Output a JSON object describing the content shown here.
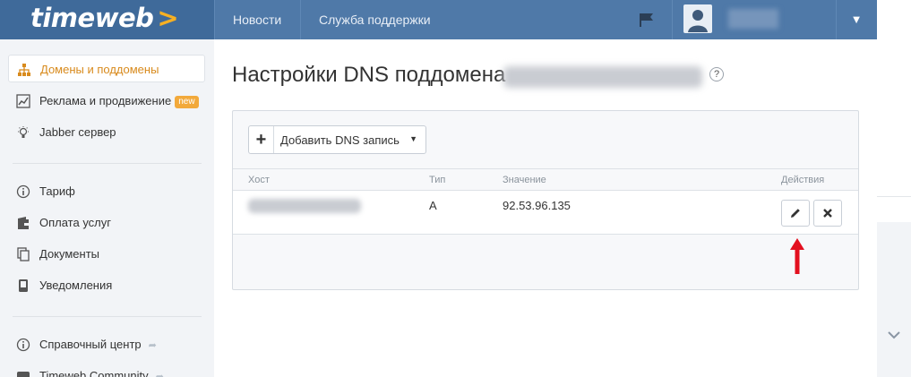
{
  "brand": {
    "logo": "timeweb",
    "logo_arrow": ">"
  },
  "topnav": {
    "news": "Новости",
    "support": "Служба поддержки",
    "user_caret": "▼"
  },
  "sidebar": {
    "items": [
      {
        "label": "Домены и поддомены",
        "icon": "sitemap-icon",
        "active": true
      },
      {
        "label": "Реклама и продвижение",
        "icon": "chart-icon",
        "badge": "new"
      },
      {
        "label": "Jabber сервер",
        "icon": "lightbulb-icon"
      },
      {
        "label": "Тариф",
        "icon": "info-icon"
      },
      {
        "label": "Оплата услуг",
        "icon": "wallet-icon"
      },
      {
        "label": "Документы",
        "icon": "documents-icon"
      },
      {
        "label": "Уведомления",
        "icon": "phone-icon"
      },
      {
        "label": "Справочный центр",
        "icon": "question-icon",
        "external": true
      },
      {
        "label": "Timeweb Community",
        "icon": "community-icon",
        "external": true
      }
    ],
    "ext_arrow": "➦"
  },
  "main": {
    "title": "Настройки DNS поддомена",
    "help": "?",
    "add_button": {
      "plus": "+",
      "label": "Добавить DNS запись",
      "caret": "▼"
    },
    "table": {
      "headers": {
        "host": "Хост",
        "type": "Тип",
        "value": "Значение",
        "actions": "Действия"
      },
      "rows": [
        {
          "type": "A",
          "value": "92.53.96.135"
        }
      ]
    }
  },
  "colors": {
    "topbar": "#4f79a8",
    "logo_bg": "#3f6a9a",
    "accent": "#d88a1c",
    "badge": "#f2a93b",
    "annotation_arrow": "#e3101f"
  }
}
